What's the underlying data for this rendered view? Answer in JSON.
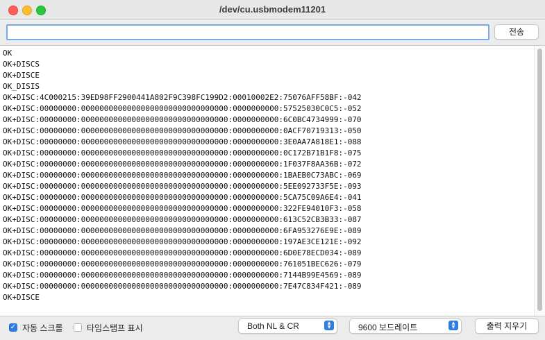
{
  "window": {
    "title": "/dev/cu.usbmodem11201"
  },
  "send": {
    "input_value": "",
    "button_label": "전송"
  },
  "output": {
    "lines": [
      "OK",
      "OK+DISCS",
      "OK+DISCE",
      "OK_DISIS",
      "OK+DISC:4C000215:39ED98FF2900441A802F9C398FC199D2:00010002E2:75076AFF58BF:-042",
      "OK+DISC:00000000:00000000000000000000000000000000:0000000000:57525030C0C5:-052",
      "OK+DISC:00000000:00000000000000000000000000000000:0000000000:6C0BC4734999:-070",
      "OK+DISC:00000000:00000000000000000000000000000000:0000000000:0ACF70719313:-050",
      "OK+DISC:00000000:00000000000000000000000000000000:0000000000:3E0AA7A818E1:-088",
      "OK+DISC:00000000:00000000000000000000000000000000:0000000000:0C172B71B1F8:-075",
      "OK+DISC:00000000:00000000000000000000000000000000:0000000000:1F037F8AA36B:-072",
      "OK+DISC:00000000:00000000000000000000000000000000:0000000000:1BAEB0C73ABC:-069",
      "OK+DISC:00000000:00000000000000000000000000000000:0000000000:5EE092733F5E:-093",
      "OK+DISC:00000000:00000000000000000000000000000000:0000000000:5CA75C09A6E4:-041",
      "OK+DISC:00000000:00000000000000000000000000000000:0000000000:322FE94010F3:-058",
      "OK+DISC:00000000:00000000000000000000000000000000:0000000000:613C52CB3B33:-087",
      "OK+DISC:00000000:00000000000000000000000000000000:0000000000:6FA953276E9E:-089",
      "OK+DISC:00000000:00000000000000000000000000000000:0000000000:197AE3CE121E:-092",
      "OK+DISC:00000000:00000000000000000000000000000000:0000000000:6D0E78ECD034:-089",
      "OK+DISC:00000000:00000000000000000000000000000000:0000000000:761051BEC626:-079",
      "OK+DISC:00000000:00000000000000000000000000000000:0000000000:7144B99E4569:-089",
      "OK+DISC:00000000:00000000000000000000000000000000:0000000000:7E47C834F421:-089",
      "OK+DISCE"
    ]
  },
  "footer": {
    "autoscroll": {
      "label": "자동 스크롤",
      "checked": true
    },
    "timestamp": {
      "label": "타임스탬프 표시",
      "checked": false
    },
    "line_ending": {
      "selected": "Both NL & CR"
    },
    "baud_rate": {
      "selected": "9600 보드레이트"
    },
    "clear_label": "출력 지우기"
  },
  "colors": {
    "accent": "#2f7de1",
    "focus_ring": "#79a9e6",
    "close": "#fe5f57",
    "minimize": "#febc2e",
    "maximize": "#28c840"
  },
  "icons": {
    "check": "check-icon",
    "select_stepper": "chevron-up-down-icon"
  }
}
